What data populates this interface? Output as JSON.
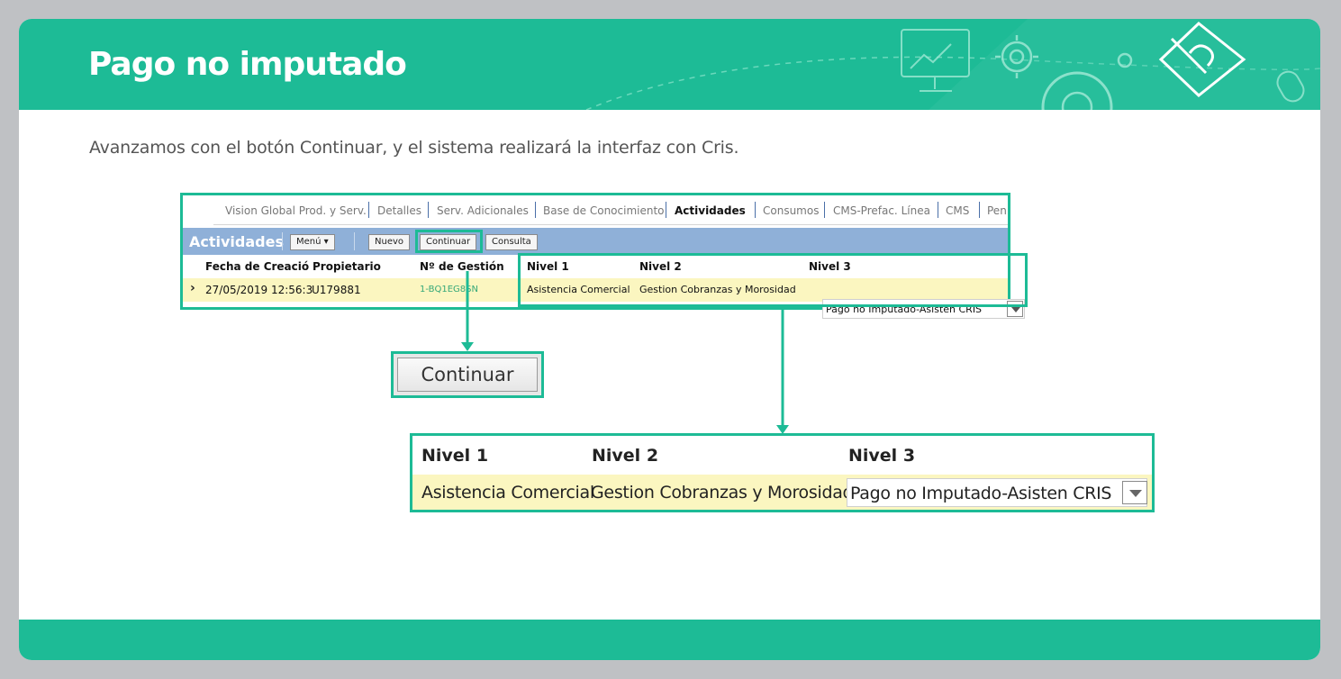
{
  "header": {
    "title": "Pago no imputado"
  },
  "subtitle": "Avanzamos con el botón Continuar, y el sistema realizará la interfaz con Cris.",
  "app": {
    "tabs": [
      {
        "label": "Vision Global Prod. y Serv."
      },
      {
        "label": "Detalles"
      },
      {
        "label": "Serv. Adicionales"
      },
      {
        "label": "Base de Conocimiento"
      },
      {
        "label": "Actividades",
        "active": true
      },
      {
        "label": "Consumos"
      },
      {
        "label": "CMS-Prefac. Línea"
      },
      {
        "label": "CMS"
      },
      {
        "label": "Pen"
      }
    ],
    "toolbar": {
      "title": "Actividades",
      "menu_label": "Menú ▾",
      "nuevo_label": "Nuevo",
      "continuar_label": "Continuar",
      "consulta_label": "Consulta"
    },
    "columns": {
      "fecha": "Fecha de Creació",
      "propietario": "Propietario",
      "gestion": "Nº de Gestión",
      "nivel1": "Nivel 1",
      "nivel2": "Nivel 2",
      "nivel3": "Nivel 3"
    },
    "row": {
      "fecha": "27/05/2019 12:56:3",
      "propietario": "U179881",
      "gestion": "1-BQ1EG8SN",
      "nivel1": "Asistencia Comercial",
      "nivel2": "Gestion Cobranzas y Morosidad",
      "nivel3": "Pago no Imputado-Asisten CRIS"
    }
  },
  "zoom_continuar": {
    "label": "Continuar"
  },
  "zoom_niveles": {
    "nivel1_header": "Nivel 1",
    "nivel2_header": "Nivel 2",
    "nivel3_header": "Nivel 3",
    "nivel1_value": "Asistencia Comercial",
    "nivel2_value": "Gestion Cobranzas y Morosidad",
    "nivel3_value": "Pago no Imputado-Asisten CRIS"
  },
  "colors": {
    "accent": "#1dbb96",
    "toolbar_blue": "#8fb0d8",
    "row_yellow": "#fbf6c0",
    "background": "#bfc1c4"
  },
  "icons": [
    "presentation-board-icon",
    "gear-icon",
    "pencil-diamond-icon",
    "mouse-icon",
    "dropdown-arrow-icon",
    "row-pointer-icon"
  ]
}
